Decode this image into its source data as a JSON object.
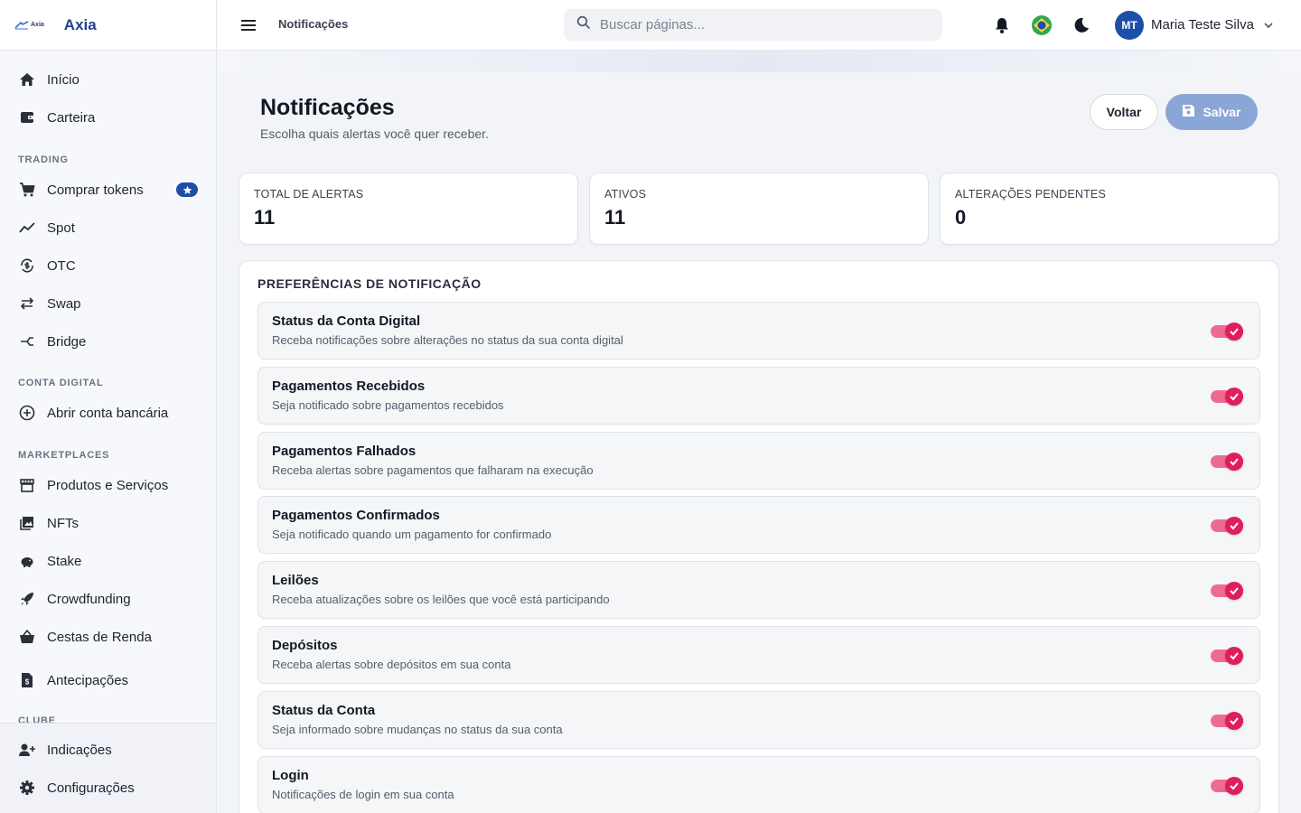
{
  "brand": {
    "mini": "Axia",
    "name": "Axia"
  },
  "sidebar": {
    "items_top": [
      {
        "label": "Início",
        "icon": "home-icon"
      },
      {
        "label": "Carteira",
        "icon": "wallet-icon"
      }
    ],
    "sections": [
      {
        "title": "TRADING",
        "items": [
          {
            "label": "Comprar tokens",
            "icon": "cart-icon",
            "badge": "star-icon"
          },
          {
            "label": "Spot",
            "icon": "trend-icon"
          },
          {
            "label": "OTC",
            "icon": "currency-exchange-icon"
          },
          {
            "label": "Swap",
            "icon": "swap-icon"
          },
          {
            "label": "Bridge",
            "icon": "merge-icon"
          }
        ]
      },
      {
        "title": "CONTA DIGITAL",
        "items": [
          {
            "label": "Abrir conta bancária",
            "icon": "add-circle-icon"
          }
        ]
      },
      {
        "title": "MARKETPLACES",
        "items": [
          {
            "label": "Produtos e Serviços",
            "icon": "storefront-icon"
          },
          {
            "label": "NFTs",
            "icon": "photo-library-icon"
          },
          {
            "label": "Stake",
            "icon": "piggy-bank-icon"
          },
          {
            "label": "Crowdfunding",
            "icon": "rocket-icon"
          },
          {
            "label": "Cestas de Renda",
            "icon": "basket-icon"
          }
        ]
      }
    ],
    "item_antecipacoes": {
      "label": "Antecipações",
      "icon": "document-dollar-icon"
    },
    "clipped_section": "CLUBE",
    "bottom": [
      {
        "label": "Indicações",
        "icon": "person-add-icon"
      },
      {
        "label": "Configurações",
        "icon": "gear-icon"
      }
    ]
  },
  "topbar": {
    "breadcrumb": "Notificações",
    "search_placeholder": "Buscar páginas...",
    "user": {
      "initials": "MT",
      "name": "Maria Teste Silva"
    }
  },
  "page": {
    "title": "Notificações",
    "subtitle": "Escolha quais alertas você quer receber.",
    "back_label": "Voltar",
    "save_label": "Salvar"
  },
  "stats": [
    {
      "label": "TOTAL DE ALERTAS",
      "value": "11"
    },
    {
      "label": "ATIVOS",
      "value": "11"
    },
    {
      "label": "ALTERAÇÕES PENDENTES",
      "value": "0"
    }
  ],
  "preferences": {
    "title": "PREFERÊNCIAS DE NOTIFICAÇÃO",
    "items": [
      {
        "name": "Status da Conta Digital",
        "desc": "Receba notificações sobre alterações no status da sua conta digital",
        "enabled": true
      },
      {
        "name": "Pagamentos Recebidos",
        "desc": "Seja notificado sobre pagamentos recebidos",
        "enabled": true
      },
      {
        "name": "Pagamentos Falhados",
        "desc": "Receba alertas sobre pagamentos que falharam na execução",
        "enabled": true
      },
      {
        "name": "Pagamentos Confirmados",
        "desc": "Seja notificado quando um pagamento for confirmado",
        "enabled": true
      },
      {
        "name": "Leilões",
        "desc": "Receba atualizações sobre os leilões que você está participando",
        "enabled": true
      },
      {
        "name": "Depósitos",
        "desc": "Receba alertas sobre depósitos em sua conta",
        "enabled": true
      },
      {
        "name": "Status da Conta",
        "desc": "Seja informado sobre mudanças no status da sua conta",
        "enabled": true
      },
      {
        "name": "Login",
        "desc": "Notificações de login em sua conta",
        "enabled": true
      }
    ]
  },
  "colors": {
    "accent": "#1e4fa8",
    "toggle_on": "#e01f5a",
    "save_button": "#8aa6d6"
  }
}
